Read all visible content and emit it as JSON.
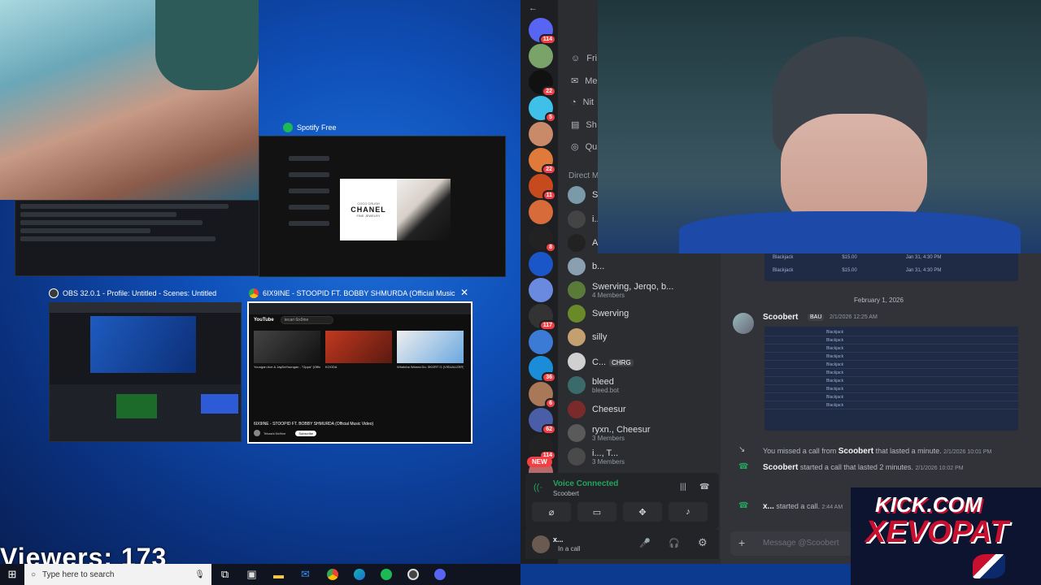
{
  "overlay": {
    "viewers_label": "Viewers: 173"
  },
  "task_view": {
    "windows": [
      {
        "title": "Spotify Free",
        "icon_color": "#1db954",
        "content": {
          "brand": "COCO CRUSH",
          "title": "CHANEL",
          "subtitle": "FINE JEWELRY"
        }
      },
      {
        "title": "OBS 32.0.1 - Profile: Untitled - Scenes: Untitled",
        "icon_color": "#3a3a3a"
      },
      {
        "title": "6IX9INE - STOOPID FT. BOBBY SHMURDA (Official Music Video) -...",
        "icon_color": "#4285f4",
        "content": {
          "site": "YouTube",
          "search": "tecari 6ix9ine",
          "videos": [
            "Youngan Ace & JayDaYoungan - \"Oppa\" (Official Music Video)",
            "KOODA",
            "Whatcha Wanna Do- 5KGRT G (VISUALIZER)"
          ],
          "now_playing": "6IX9INE - STOOPID FT. BOBBY SHMURDA (Official Music Video)",
          "channel": "Tekashi 6ix9ine",
          "subscribe": "Subscribe"
        }
      }
    ]
  },
  "taskbar": {
    "search_placeholder": "Type here to search",
    "start_icon": "windows-logo-icon",
    "apps": [
      "task-view-icon",
      "store-icon",
      "file-explorer-icon",
      "mail-icon",
      "chrome-icon",
      "edge-icon",
      "spotify-icon",
      "obs-icon",
      "discord-icon"
    ]
  },
  "discord": {
    "servers": [
      {
        "badge": "114"
      },
      {
        "badge": ""
      },
      {
        "badge": "22"
      },
      {
        "badge": "5"
      },
      {
        "badge": ""
      },
      {
        "badge": "22"
      },
      {
        "badge": "11"
      },
      {
        "badge": ""
      },
      {
        "badge": "8"
      },
      {
        "badge": ""
      },
      {
        "badge": ""
      },
      {
        "badge": "117"
      },
      {
        "badge": ""
      },
      {
        "badge": "36"
      },
      {
        "badge": "6"
      },
      {
        "badge": "62"
      },
      {
        "badge": "114"
      },
      {
        "badge": ""
      }
    ],
    "new_badge": "NEW",
    "nav": [
      "Fri",
      "Me",
      "Nit",
      "Sh",
      "Qu"
    ],
    "dm_header": "Direct M",
    "dms": [
      {
        "name": "S",
        "sub": ""
      },
      {
        "name": "i..",
        "sub": ""
      },
      {
        "name": "A",
        "sub": ""
      },
      {
        "name": "b...",
        "sub": ""
      },
      {
        "name": "Swerving, Jerqo, b...",
        "sub": "4 Members"
      },
      {
        "name": "Swerving",
        "sub": ""
      },
      {
        "name": "silly",
        "sub": ""
      },
      {
        "name": "C...",
        "sub": "",
        "tag": "CHRG"
      },
      {
        "name": "bleed",
        "sub": "bleed.bot"
      },
      {
        "name": "Cheesur",
        "sub": ""
      },
      {
        "name": "ryxn., Cheesur",
        "sub": "3 Members"
      },
      {
        "name": "i..., T...",
        "sub": "3 Members"
      }
    ],
    "voice": {
      "status": "Voice Connected",
      "channel": "Scoobert"
    },
    "user": {
      "name": "x...",
      "status": "In a call"
    },
    "chat": {
      "table_top": [
        {
          "game": "Blackjack",
          "amount": "$15.00",
          "date": "Jan 31, 4:30 PM"
        },
        {
          "game": "Blackjack",
          "amount": "$15.00",
          "date": "Jan 31, 4:30 PM"
        }
      ],
      "date_divider": "February 1, 2026",
      "msg_author": "Scoobert",
      "msg_tag": "BAU",
      "msg_time": "2/1/2026 12:25 AM",
      "table_rows": [
        "Blackjack",
        "Blackjack",
        "Blackjack",
        "Blackjack",
        "Blackjack",
        "Blackjack",
        "Blackjack",
        "Blackjack",
        "Blackjack",
        "Blackjack"
      ],
      "missed_call": {
        "prefix": "You missed a call from",
        "who": "Scoobert",
        "suffix": "that lasted a minute.",
        "time": "2/1/2026 10:01 PM"
      },
      "started_call": {
        "who": "Scoobert",
        "suffix": "started a call that lasted 2 minutes.",
        "time": "2/1/2026 10:02 PM"
      },
      "started_call2": {
        "who": "x...",
        "suffix": "started a call.",
        "time": "2:44 AM"
      },
      "input_placeholder": "Message @Scoobert"
    }
  },
  "branding": {
    "line1": "KICK.COM",
    "line2": "XEVOPAT"
  },
  "colors": {
    "discord_green": "#23a55a",
    "discord_red": "#f23f43",
    "blurple": "#5865f2"
  }
}
